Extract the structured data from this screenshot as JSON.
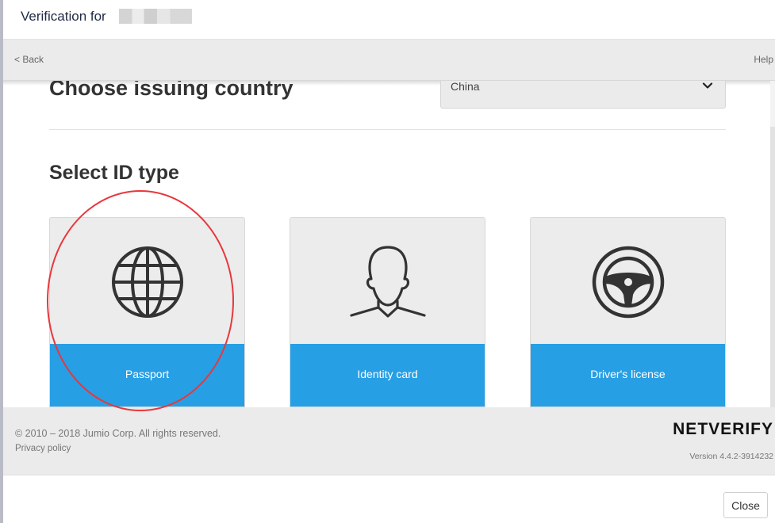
{
  "header": {
    "title": "Verification for"
  },
  "navbar": {
    "back_label": "< Back",
    "help_label": "Help"
  },
  "country_section": {
    "heading": "Choose issuing country",
    "selected_country": "China"
  },
  "id_section": {
    "heading": "Select ID type",
    "options": [
      {
        "label": "Passport",
        "icon": "globe-icon"
      },
      {
        "label": "Identity card",
        "icon": "person-icon"
      },
      {
        "label": "Driver's license",
        "icon": "steering-wheel-icon"
      }
    ]
  },
  "footer": {
    "copyright": "© 2010 – 2018 Jumio Corp. All rights reserved.",
    "privacy_label": "Privacy policy",
    "brand": "NETVERIFY",
    "version": "Version 4.4.2-3914232"
  },
  "dialog": {
    "close_label": "Close"
  },
  "colors": {
    "accent": "#279fe4",
    "annotation": "#e8373c",
    "panel": "#ebebeb"
  }
}
